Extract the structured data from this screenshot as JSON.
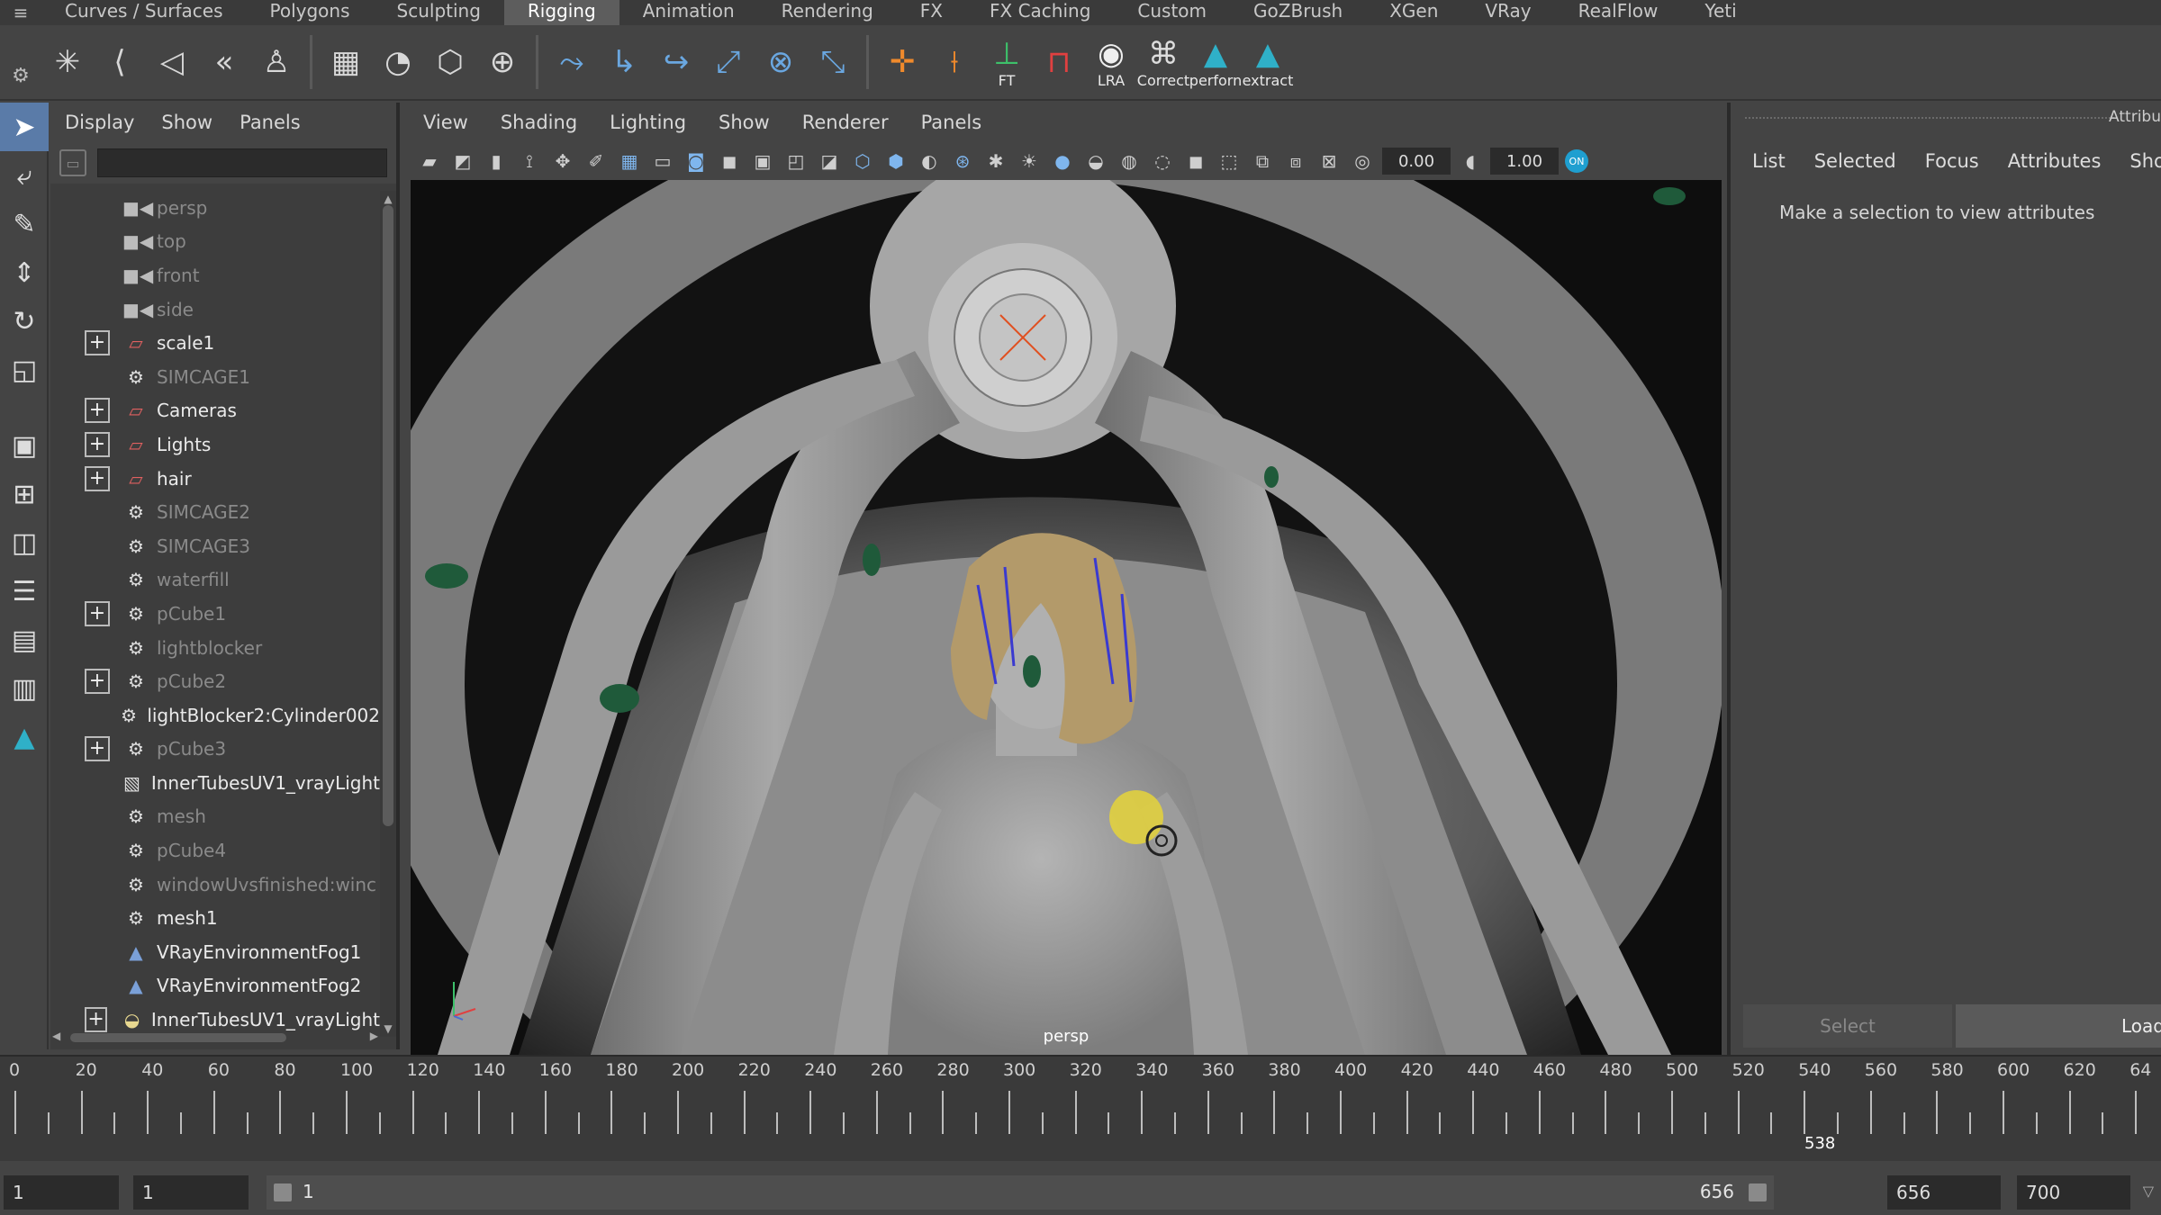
{
  "shelf": {
    "tabs": [
      "Curves / Surfaces",
      "Polygons",
      "Sculpting",
      "Rigging",
      "Animation",
      "Rendering",
      "FX",
      "FX Caching",
      "Custom",
      "GoZBrush",
      "XGen",
      "VRay",
      "RealFlow",
      "Yeti"
    ],
    "active_tab": "Rigging",
    "tool_captions": {
      "ft": "FT",
      "lra": "LRA",
      "correct": "Correct",
      "perform": "perforn",
      "extract": "extract"
    }
  },
  "outliner": {
    "menu": [
      "Display",
      "Show",
      "Panels"
    ],
    "search_value": "",
    "items": [
      {
        "label": "persp",
        "icon": "camera-icon",
        "expandable": false,
        "dim": true
      },
      {
        "label": "top",
        "icon": "camera-icon",
        "expandable": false,
        "dim": true
      },
      {
        "label": "front",
        "icon": "camera-icon",
        "expandable": false,
        "dim": true
      },
      {
        "label": "side",
        "icon": "camera-icon",
        "expandable": false,
        "dim": true
      },
      {
        "label": "scale1",
        "icon": "group-icon",
        "expandable": true,
        "dim": false
      },
      {
        "label": "SIMCAGE1",
        "icon": "mesh-icon",
        "expandable": false,
        "dim": true
      },
      {
        "label": "Cameras",
        "icon": "group-icon",
        "expandable": true,
        "dim": false
      },
      {
        "label": "Lights",
        "icon": "group-icon",
        "expandable": true,
        "dim": false
      },
      {
        "label": "hair",
        "icon": "group-icon",
        "expandable": true,
        "dim": false
      },
      {
        "label": "SIMCAGE2",
        "icon": "mesh-icon",
        "expandable": false,
        "dim": true
      },
      {
        "label": "SIMCAGE3",
        "icon": "mesh-icon",
        "expandable": false,
        "dim": true
      },
      {
        "label": "waterfill",
        "icon": "mesh-icon",
        "expandable": false,
        "dim": true
      },
      {
        "label": "pCube1",
        "icon": "mesh-icon",
        "expandable": true,
        "dim": true
      },
      {
        "label": "lightblocker",
        "icon": "mesh-icon",
        "expandable": false,
        "dim": true
      },
      {
        "label": "pCube2",
        "icon": "mesh-icon",
        "expandable": true,
        "dim": true
      },
      {
        "label": "lightBlocker2:Cylinder002",
        "icon": "mesh-icon",
        "expandable": false,
        "dim": false
      },
      {
        "label": "pCube3",
        "icon": "mesh-icon",
        "expandable": true,
        "dim": true
      },
      {
        "label": "InnerTubesUV1_vrayLight",
        "icon": "light-icon",
        "expandable": false,
        "dim": false
      },
      {
        "label": "mesh",
        "icon": "mesh-icon",
        "expandable": false,
        "dim": true
      },
      {
        "label": "pCube4",
        "icon": "mesh-icon",
        "expandable": false,
        "dim": true
      },
      {
        "label": "windowUvsfinished:winc",
        "icon": "mesh-icon",
        "expandable": false,
        "dim": true
      },
      {
        "label": "mesh1",
        "icon": "mesh-icon",
        "expandable": false,
        "dim": false
      },
      {
        "label": "VRayEnvironmentFog1",
        "icon": "fog-icon",
        "expandable": false,
        "dim": false
      },
      {
        "label": "VRayEnvironmentFog2",
        "icon": "fog-icon",
        "expandable": false,
        "dim": false
      },
      {
        "label": "InnerTubesUV1_vrayLight",
        "icon": "bulb-icon",
        "expandable": true,
        "dim": false
      }
    ]
  },
  "viewport": {
    "menu": [
      "View",
      "Shading",
      "Lighting",
      "Show",
      "Renderer",
      "Panels"
    ],
    "field_a": "0.00",
    "field_b": "1.00",
    "camera_label": "persp"
  },
  "attribute_editor": {
    "title": "Attribu",
    "tabs": [
      "List",
      "Selected",
      "Focus",
      "Attributes",
      "Show"
    ],
    "message": "Make a selection to view attributes",
    "select_button": "Select",
    "load_button": "Load"
  },
  "timeline": {
    "tick_labels": [
      "0",
      "20",
      "40",
      "60",
      "80",
      "100",
      "120",
      "140",
      "160",
      "180",
      "200",
      "220",
      "240",
      "260",
      "280",
      "300",
      "320",
      "340",
      "360",
      "380",
      "400",
      "420",
      "440",
      "460",
      "480",
      "500",
      "520",
      "540",
      "560",
      "580",
      "600",
      "620",
      "64"
    ],
    "current_frame": "538"
  },
  "range": {
    "anim_start": "1",
    "playback_start": "1",
    "range_start_label": "1",
    "range_end_label": "656",
    "playback_end": "656",
    "anim_end": "700"
  },
  "colors": {
    "accent": "#5a7ba8",
    "active_tab": "#5d5d5d",
    "hair": "#b39a6a",
    "cursor_highlight": "#e5d43a"
  }
}
